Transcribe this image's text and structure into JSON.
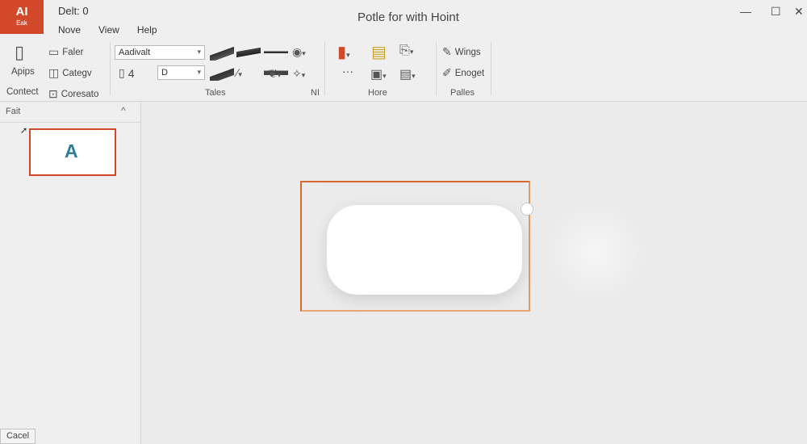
{
  "app": {
    "badge_main": "AI",
    "badge_sub": "Eak"
  },
  "document": {
    "label": "Delt: 0"
  },
  "window": {
    "title": "Potle for with Hoint",
    "minimize_glyph": "—",
    "maximize_glyph": "☐",
    "close_glyph": "✕"
  },
  "menu": {
    "items": [
      "Nove",
      "View",
      "Help"
    ]
  },
  "ribbon": {
    "left": {
      "items": [
        "Faler",
        "Categv",
        "Apips",
        "Contect",
        "Coresato"
      ]
    },
    "tales": {
      "font_select": "Aadivalt",
      "size_select": "D",
      "size_prefix": "4",
      "group_label": "Tales",
      "corner_label": "NI"
    },
    "hore": {
      "group_label": "Hore",
      "dots": "···"
    },
    "palles": {
      "items": [
        "Wings",
        "Enoget"
      ],
      "group_label": "Palles"
    },
    "icons": [
      "clipboard-icon",
      "document-icon",
      "category-icon",
      "camera-icon",
      "globe-icon",
      "shapes-icon",
      "magic-icon",
      "paste-icon",
      "copy-icon",
      "format-icon",
      "layout-icon",
      "wings-icon",
      "engage-icon"
    ]
  },
  "left_pane": {
    "title": "Fait",
    "collapse_glyph": "^",
    "thumbnail_letter": "A",
    "cancel_label": "Cacel"
  },
  "colors": {
    "accent": "#d2492a",
    "selection": "#d6692f",
    "thumb_letter": "#2f7e9a"
  }
}
